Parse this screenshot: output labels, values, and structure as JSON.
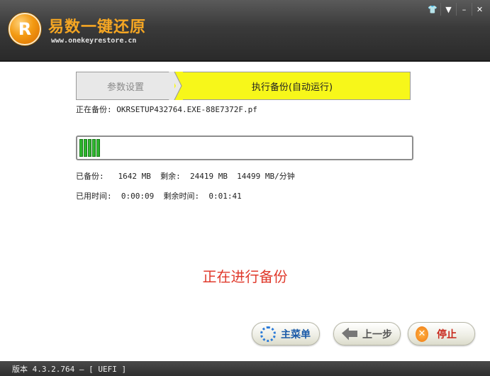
{
  "app": {
    "title": "易数一键还原",
    "url": "www.onekeyrestore.cn",
    "logo_glyph": "R"
  },
  "window_controls": {
    "skin_icon": "👕",
    "menu_icon": "▼",
    "minimize": "–",
    "close": "✕"
  },
  "steps": {
    "step1": "参数设置",
    "step2": "执行备份(自动运行)"
  },
  "current_file": "正在备份: OKRSETUP432764.EXE-88E7372F.pf",
  "progress": {
    "percent": 4,
    "segments": 5
  },
  "stats": {
    "line1": "已备份:   1642 MB  剩余:  24419 MB  14499 MB/分钟",
    "line2": "已用时间:  0:00:09  剩余时间:  0:01:41"
  },
  "status_message": "正在进行备份",
  "buttons": {
    "menu": "主菜单",
    "prev": "上一步",
    "stop": "停止"
  },
  "statusbar": {
    "text": "版本 4.3.2.764 — [ UEFI ]"
  },
  "colors": {
    "accent": "#f5a623",
    "active_step": "#f7f71a",
    "status_red": "#e03a2c",
    "progress_green": "#33cc33"
  }
}
